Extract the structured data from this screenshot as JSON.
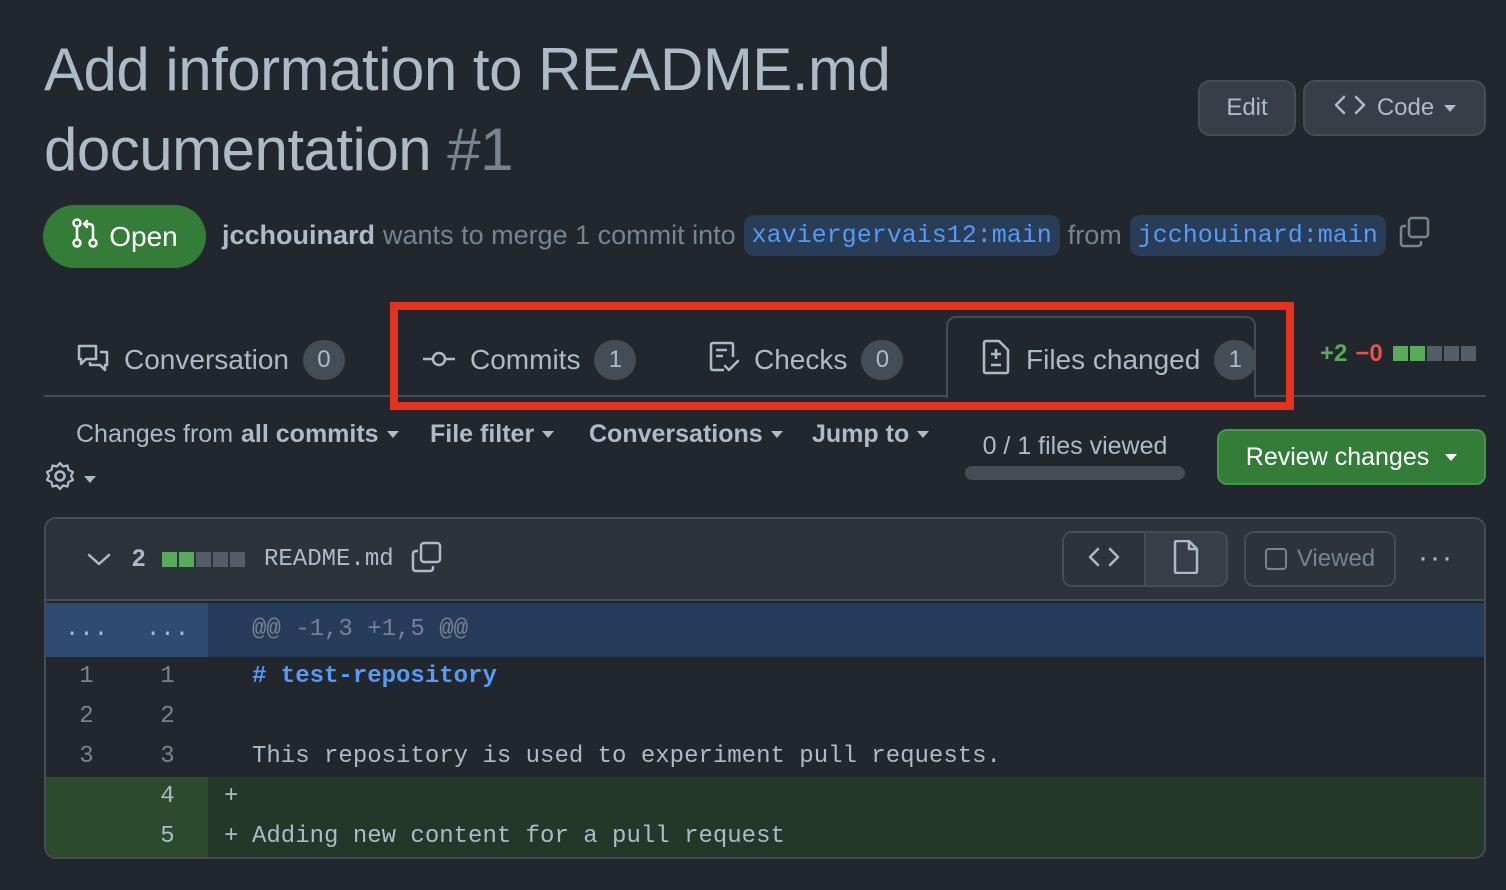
{
  "pr": {
    "title_line1": "Add information to README.md",
    "title_line2": "documentation",
    "number": "#1",
    "state": "Open",
    "author": "jcchouinard",
    "merge_text": "wants to merge 1 commit into",
    "base_branch": "xaviergervais12:main",
    "from_text": "from",
    "head_branch": "jcchouinard:main"
  },
  "header_actions": {
    "edit": "Edit",
    "code": "Code"
  },
  "tabs": [
    {
      "label": "Conversation",
      "count": "0",
      "icon": "comment-discussion-icon"
    },
    {
      "label": "Commits",
      "count": "1",
      "icon": "git-commit-icon"
    },
    {
      "label": "Checks",
      "count": "0",
      "icon": "checklist-icon"
    },
    {
      "label": "Files changed",
      "count": "1",
      "icon": "file-diff-icon",
      "selected": true
    }
  ],
  "diffstat": {
    "additions": "+2",
    "deletions": "−0"
  },
  "toolbar": {
    "changes_prefix": "Changes from",
    "changes_value": "all commits",
    "file_filter": "File filter",
    "conversations": "Conversations",
    "jump_to": "Jump to",
    "files_viewed": "0 / 1 files viewed",
    "files_viewed_fraction": 0,
    "review_changes": "Review changes"
  },
  "file": {
    "changes_count": "2",
    "name": "README.md",
    "viewed_label": "Viewed",
    "viewed": false
  },
  "diff": {
    "hunk": {
      "old": "...",
      "new": "...",
      "header": "@@ -1,3 +1,5 @@"
    },
    "lines": [
      {
        "old": "1",
        "new": "1",
        "marker": " ",
        "text": "# test-repository"
      },
      {
        "old": "2",
        "new": "2",
        "marker": " ",
        "text": ""
      },
      {
        "old": "3",
        "new": "3",
        "marker": " ",
        "text": "This repository is used to experiment pull requests."
      },
      {
        "old": "",
        "new": "4",
        "marker": "+",
        "text": ""
      },
      {
        "old": "",
        "new": "5",
        "marker": "+",
        "text": "Adding new content for a pull request"
      }
    ]
  },
  "colors": {
    "background": "#22272e",
    "open_green": "#347d39",
    "branch_blue": "#539bf5",
    "highlight_red": "#e5321c",
    "addition_bg": "#24382a"
  }
}
